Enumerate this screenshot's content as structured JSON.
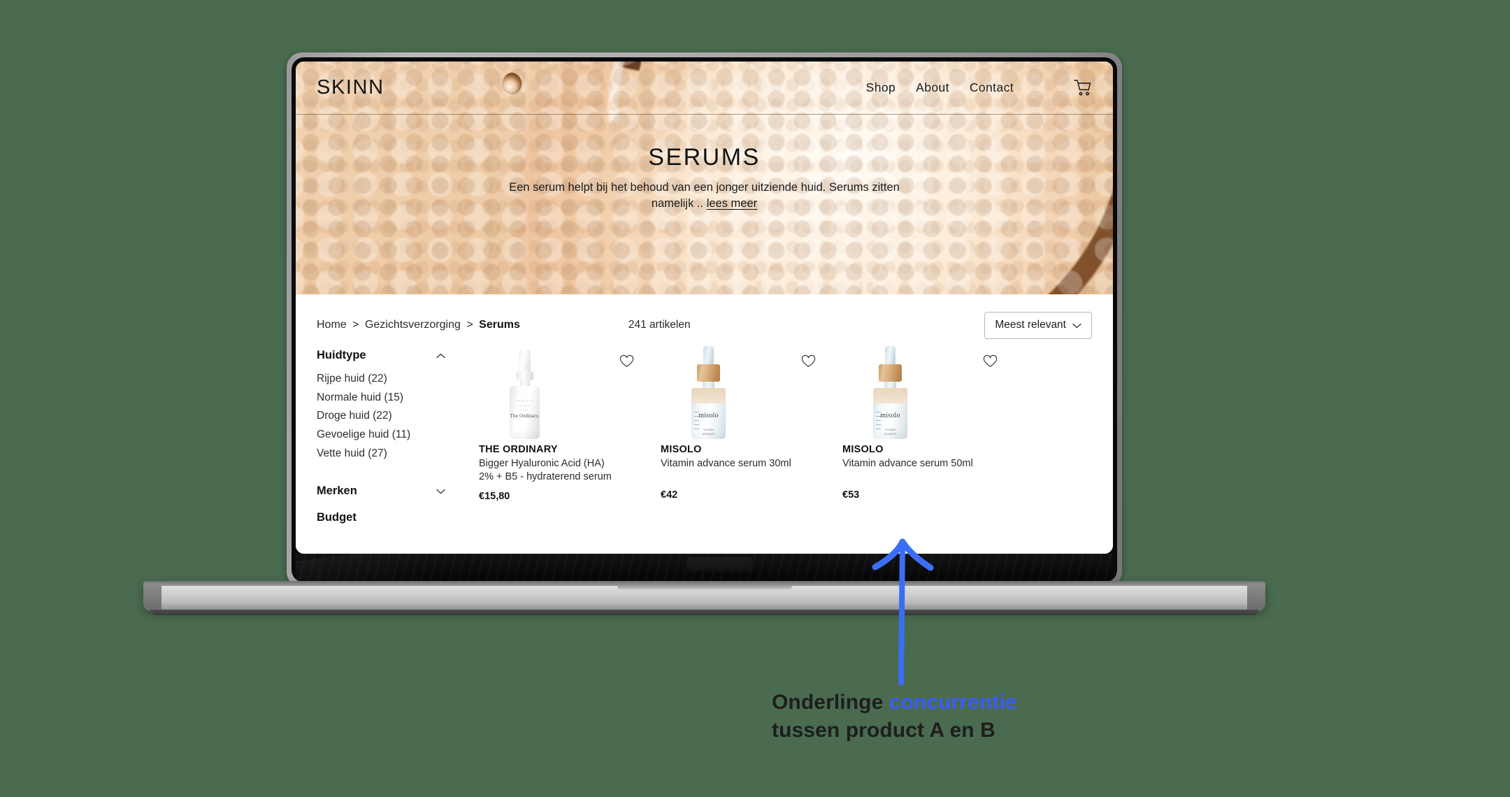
{
  "background_color": "#4a6b4f",
  "site": {
    "brand": "SKINN",
    "nav": [
      {
        "label": "Shop",
        "name": "nav-shop"
      },
      {
        "label": "About",
        "name": "nav-about"
      },
      {
        "label": "Contact",
        "name": "nav-contact"
      }
    ],
    "cart_icon": "shopping-cart-icon",
    "hero": {
      "title": "SERUMS",
      "subtitle_line1": "Een serum helpt bij het behoud  van een jonger uitziende",
      "subtitle_line2": "huid. Serums zitten namelijk  ..",
      "read_more": "lees meer"
    }
  },
  "toolbar": {
    "breadcrumb": {
      "items": [
        "Home",
        "Gezichtsverzorging"
      ],
      "separator": ">",
      "current": "Serums"
    },
    "count": "241 artikelen",
    "sort": {
      "selected": "Meest relevant",
      "chevron": "⌄"
    }
  },
  "filters": [
    {
      "title": "Huidtype",
      "name": "filter-huidtype",
      "expanded": true,
      "chevron": "⌃",
      "options": [
        "Rijpe huid (22)",
        "Normale huid (15)",
        "Droge huid (22)",
        "Gevoelige huid (11)",
        "Vette huid (27)"
      ]
    },
    {
      "title": "Merken",
      "name": "filter-merken",
      "expanded": false,
      "chevron": "⌄",
      "options": []
    },
    {
      "title": "Budget",
      "name": "filter-budget",
      "expanded": false,
      "chevron": "",
      "options": []
    }
  ],
  "products": [
    {
      "brand": "THE ORDINARY",
      "name_line1": "Bigger Hyaluronic Acid (HA)",
      "name_line2": "2% + B5 - hydraterend serum",
      "price": "€15,80",
      "favorite_icon": "heart-outline-icon",
      "bottle_label_top": "THE ORDINARY\nHYALURONIC\nSERUM",
      "bottle_brand": "The Ordinary.",
      "bottle_label_bottom": "Hyaluronic Acid 2% + B5\nhydration support formula"
    },
    {
      "brand": "MISOLO",
      "name_line1": "Vitamin advance serum 30ml",
      "name_line2": "",
      "price": "€42",
      "favorite_icon": "heart-outline-icon",
      "bottle_brand": "misolo",
      "bottle_label_bottom": "VITAMIN\nADVANCE"
    },
    {
      "brand": "MISOLO",
      "name_line1": "Vitamin advance serum 50ml",
      "name_line2": "",
      "price": "€53",
      "favorite_icon": "heart-outline-icon",
      "bottle_brand": "misolo",
      "bottle_label_bottom": "VITAMIN\nADVANCE"
    }
  ],
  "annotation": {
    "line1_prefix": "Onderlinge ",
    "line1_accent": "concurrentie",
    "line2": "tussen product A en B",
    "accent_color": "#3b5bfd",
    "arrow_icon": "up-arrow-annotation"
  }
}
